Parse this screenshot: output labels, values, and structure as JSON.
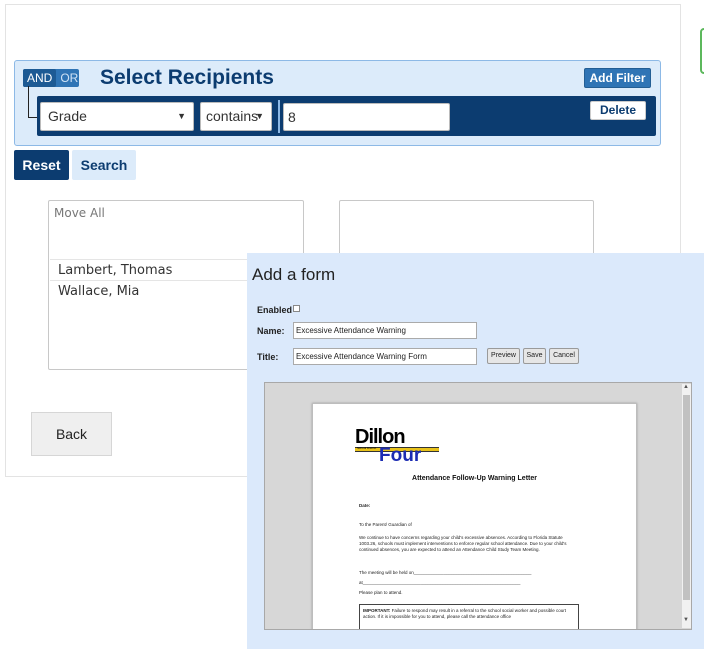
{
  "recipients": {
    "logic": {
      "and": "AND",
      "or": "OR"
    },
    "title": "Select Recipients",
    "add_filter": "Add Filter",
    "filter": {
      "field": "Grade",
      "operator": "contains",
      "value": "8",
      "delete": "Delete"
    }
  },
  "actions": {
    "reset": "Reset",
    "search": "Search",
    "back": "Back"
  },
  "students": {
    "move_all": "Move All",
    "items": [
      "Lambert, Thomas",
      "Wallace, Mia"
    ]
  },
  "form": {
    "heading": "Add a form",
    "enabled_label": "Enabled",
    "name_label": "Name:",
    "name_value": "Excessive Attendance Warning",
    "title_label": "Title:",
    "title_value": "Excessive Attendance Warning Form",
    "preview": "Preview",
    "save": "Save",
    "cancel": "Cancel"
  },
  "document": {
    "logo_top": "Dillon",
    "logo_sub": "School District",
    "logo_bottom": "Four",
    "heading": "Attendance Follow-Up Warning Letter",
    "date_label": "Date:",
    "salutation": "To the Parent/ Guardian of",
    "body": "We continue to have concerns regarding your child's excessive absences. According to Florida Statute 1003.26, schools must implement interventions to enforce regular school attendance. Due to your child's continued absences, you are expected to attend an Attendance Child Study Team Meeting.",
    "meeting_line": "The meeting will be held on_______________________________________________",
    "at_line": "at_______________________________________________________________",
    "please": "Please plan to attend.",
    "important_label": "IMPORTANT:",
    "important_text": " Failure to respond may result in a referral to the school social worker and possible court action. If it is impossible for you to attend, please call the attendance office"
  }
}
